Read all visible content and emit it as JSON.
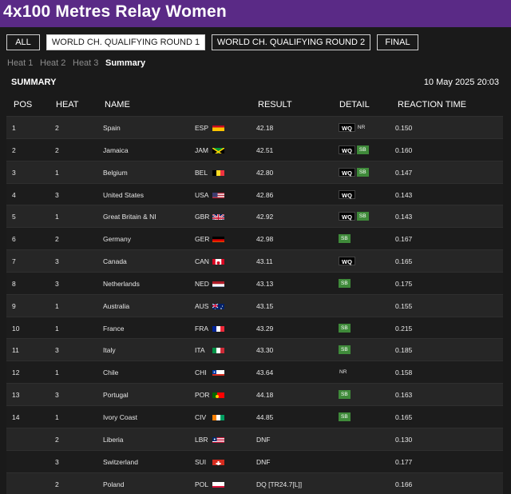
{
  "page": {
    "title": "4x100 Metres Relay Women"
  },
  "round_tabs": [
    {
      "label": "ALL",
      "active": false
    },
    {
      "label": "WORLD CH. QUALIFYING ROUND 1",
      "active": true
    },
    {
      "label": "WORLD CH. QUALIFYING ROUND 2",
      "active": false
    },
    {
      "label": "FINAL",
      "active": false
    }
  ],
  "heat_tabs": [
    {
      "label": "Heat 1",
      "active": false
    },
    {
      "label": "Heat 2",
      "active": false
    },
    {
      "label": "Heat 3",
      "active": false
    },
    {
      "label": "Summary",
      "active": true
    }
  ],
  "summary": {
    "label": "SUMMARY",
    "datetime": "10 May 2025 20:03"
  },
  "columns": {
    "pos": "POS",
    "heat": "HEAT",
    "name": "NAME",
    "result": "RESULT",
    "detail": "DETAIL",
    "reaction": "REACTION TIME"
  },
  "rows": [
    {
      "pos": "1",
      "heat": "2",
      "name": "Spain",
      "code": "ESP",
      "flag": "ESP",
      "result": "42.18",
      "detail": [
        "WQ",
        "NR"
      ],
      "reaction": "0.150"
    },
    {
      "pos": "2",
      "heat": "2",
      "name": "Jamaica",
      "code": "JAM",
      "flag": "JAM",
      "result": "42.51",
      "detail": [
        "WQ",
        "SB"
      ],
      "reaction": "0.160"
    },
    {
      "pos": "3",
      "heat": "1",
      "name": "Belgium",
      "code": "BEL",
      "flag": "BEL",
      "result": "42.80",
      "detail": [
        "WQ",
        "SB"
      ],
      "reaction": "0.147"
    },
    {
      "pos": "4",
      "heat": "3",
      "name": "United States",
      "code": "USA",
      "flag": "USA",
      "result": "42.86",
      "detail": [
        "WQ"
      ],
      "reaction": "0.143"
    },
    {
      "pos": "5",
      "heat": "1",
      "name": "Great Britain & NI",
      "code": "GBR",
      "flag": "GBR",
      "result": "42.92",
      "detail": [
        "WQ",
        "SB"
      ],
      "reaction": "0.143"
    },
    {
      "pos": "6",
      "heat": "2",
      "name": "Germany",
      "code": "GER",
      "flag": "GER",
      "result": "42.98",
      "detail": [
        "SB"
      ],
      "reaction": "0.167"
    },
    {
      "pos": "7",
      "heat": "3",
      "name": "Canada",
      "code": "CAN",
      "flag": "CAN",
      "result": "43.11",
      "detail": [
        "WQ"
      ],
      "reaction": "0.165"
    },
    {
      "pos": "8",
      "heat": "3",
      "name": "Netherlands",
      "code": "NED",
      "flag": "NED",
      "result": "43.13",
      "detail": [
        "SB"
      ],
      "reaction": "0.175"
    },
    {
      "pos": "9",
      "heat": "1",
      "name": "Australia",
      "code": "AUS",
      "flag": "AUS",
      "result": "43.15",
      "detail": [],
      "reaction": "0.155"
    },
    {
      "pos": "10",
      "heat": "1",
      "name": "France",
      "code": "FRA",
      "flag": "FRA",
      "result": "43.29",
      "detail": [
        "SB"
      ],
      "reaction": "0.215"
    },
    {
      "pos": "11",
      "heat": "3",
      "name": "Italy",
      "code": "ITA",
      "flag": "ITA",
      "result": "43.30",
      "detail": [
        "SB"
      ],
      "reaction": "0.185"
    },
    {
      "pos": "12",
      "heat": "1",
      "name": "Chile",
      "code": "CHI",
      "flag": "CHI",
      "result": "43.64",
      "detail": [
        "NR"
      ],
      "reaction": "0.158"
    },
    {
      "pos": "13",
      "heat": "3",
      "name": "Portugal",
      "code": "POR",
      "flag": "POR",
      "result": "44.18",
      "detail": [
        "SB"
      ],
      "reaction": "0.163"
    },
    {
      "pos": "14",
      "heat": "1",
      "name": "Ivory Coast",
      "code": "CIV",
      "flag": "CIV",
      "result": "44.85",
      "detail": [
        "SB"
      ],
      "reaction": "0.165"
    },
    {
      "pos": "",
      "heat": "2",
      "name": "Liberia",
      "code": "LBR",
      "flag": "LBR",
      "result": "DNF",
      "detail": [],
      "reaction": "0.130"
    },
    {
      "pos": "",
      "heat": "3",
      "name": "Switzerland",
      "code": "SUI",
      "flag": "SUI",
      "result": "DNF",
      "detail": [],
      "reaction": "0.177"
    },
    {
      "pos": "",
      "heat": "2",
      "name": "Poland",
      "code": "POL",
      "flag": "POL",
      "result": "DQ [TR24.7[L]]",
      "detail": [],
      "reaction": "0.166"
    }
  ],
  "colors": {
    "header_bg": "#5a2a86",
    "page_bg": "#1a1a1a",
    "sb_badge": "#3f8a3a"
  }
}
